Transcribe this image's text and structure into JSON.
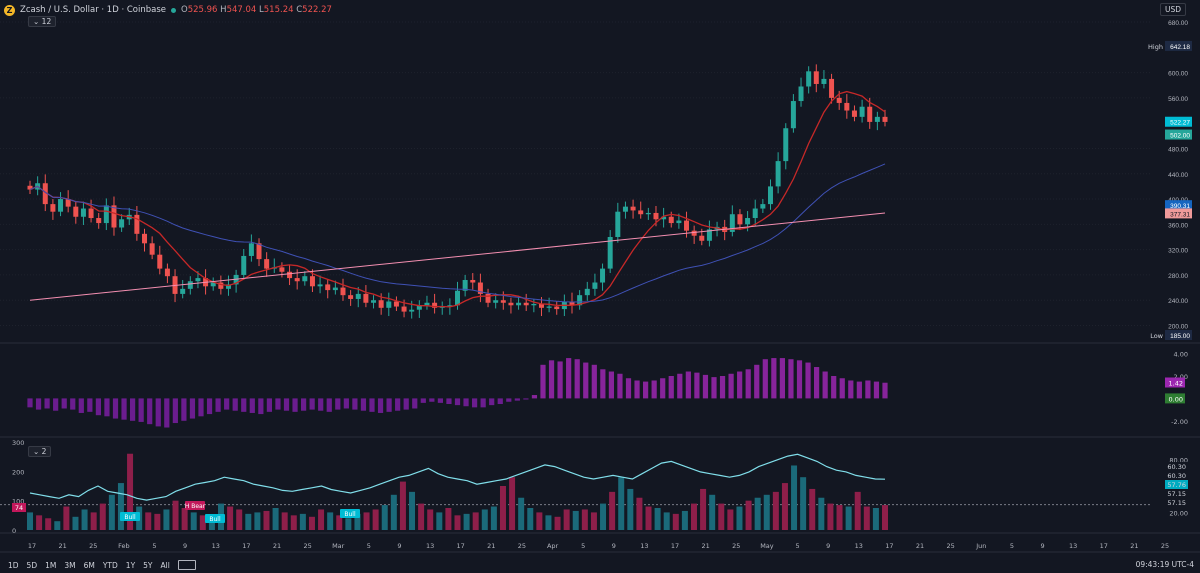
{
  "header": {
    "symbol": "Zcash / U.S. Dollar · 1D · Coinbase",
    "logo": "Z",
    "open_label": "O",
    "open": "525.96",
    "high_label": "H",
    "high": "547.04",
    "low_label": "L",
    "low": "515.24",
    "close_label": "C",
    "close": "522.27"
  },
  "toolbar": {
    "currency": "USD",
    "indicator_count_main": "12",
    "indicator_count_osc": "2",
    "timeframes": [
      "1D",
      "5D",
      "1M",
      "3M",
      "6M",
      "YTD",
      "1Y",
      "5Y",
      "All"
    ],
    "clock": "09:43:19 UTC-4"
  },
  "chart_data": [
    {
      "type": "candlestick",
      "pane": "price",
      "ylim": [
        185,
        680
      ],
      "y_ticks": [
        "680.00",
        "600.00",
        "560.00",
        "480.00",
        "440.00",
        "400.00",
        "360.00",
        "320.00",
        "280.00",
        "240.00",
        "200.00"
      ],
      "x_ticks": [
        "17",
        "21",
        "25",
        "Feb",
        "5",
        "9",
        "13",
        "17",
        "21",
        "25",
        "Mar",
        "5",
        "9",
        "13",
        "17",
        "21",
        "25",
        "Apr",
        "5",
        "9",
        "13",
        "17",
        "21",
        "25",
        "May",
        "5",
        "9",
        "13",
        "17",
        "21",
        "25",
        "Jun",
        "5",
        "9",
        "13",
        "17",
        "21",
        "25"
      ],
      "price_labels": {
        "high": "642.18",
        "high_label": "High",
        "low": "185.00",
        "low_label": "Low",
        "last": "522.27",
        "ma1": "390.31",
        "ma2": "377.31",
        "ma3": "502.00"
      },
      "candles": [
        415,
        425,
        392,
        380,
        400,
        388,
        372,
        385,
        370,
        362,
        390,
        355,
        368,
        375,
        345,
        330,
        312,
        290,
        278,
        250,
        258,
        270,
        275,
        262,
        268,
        258,
        265,
        280,
        310,
        330,
        305,
        290,
        292,
        285,
        275,
        270,
        278,
        262,
        265,
        256,
        260,
        248,
        242,
        250,
        236,
        240,
        228,
        238,
        230,
        222,
        225,
        232,
        236,
        228,
        230,
        232,
        255,
        272,
        268,
        250,
        236,
        240,
        236,
        232,
        236,
        232,
        234,
        228,
        230,
        226,
        238,
        232,
        248,
        258,
        268,
        290,
        340,
        380,
        388,
        382,
        376,
        378,
        368,
        372,
        362,
        366,
        350,
        342,
        334,
        352,
        356,
        348,
        376,
        360,
        370,
        385,
        392,
        420,
        460,
        512,
        555,
        578,
        602,
        582,
        590,
        560,
        552,
        540,
        530,
        546,
        522,
        530,
        522
      ]
    },
    {
      "type": "histogram",
      "pane": "momentum",
      "y_ticks": [
        "4.00",
        "2.00",
        "-2.00"
      ],
      "labels": {
        "current": "1.42",
        "zero": "0.00"
      },
      "values": [
        -0.8,
        -1.0,
        -0.9,
        -1.1,
        -0.9,
        -1.0,
        -1.3,
        -1.2,
        -1.5,
        -1.6,
        -1.8,
        -1.9,
        -2.0,
        -2.1,
        -2.3,
        -2.5,
        -2.6,
        -2.2,
        -2.0,
        -1.8,
        -1.6,
        -1.4,
        -1.2,
        -1.0,
        -1.1,
        -1.2,
        -1.3,
        -1.4,
        -1.2,
        -1.0,
        -1.1,
        -1.2,
        -1.1,
        -1.0,
        -1.1,
        -1.2,
        -1.0,
        -0.9,
        -1.0,
        -1.1,
        -1.2,
        -1.3,
        -1.2,
        -1.1,
        -1.0,
        -0.9,
        -0.4,
        -0.3,
        -0.4,
        -0.5,
        -0.6,
        -0.7,
        -0.8,
        -0.8,
        -0.6,
        -0.5,
        -0.3,
        -0.2,
        -0.1,
        0.3,
        3.0,
        3.4,
        3.3,
        3.6,
        3.5,
        3.2,
        3.0,
        2.6,
        2.4,
        2.2,
        1.8,
        1.6,
        1.5,
        1.6,
        1.8,
        2.0,
        2.2,
        2.4,
        2.3,
        2.1,
        1.9,
        2.0,
        2.2,
        2.4,
        2.6,
        3.0,
        3.5,
        3.6,
        3.6,
        3.5,
        3.4,
        3.2,
        2.8,
        2.4,
        2.0,
        1.8,
        1.6,
        1.5,
        1.6,
        1.5,
        1.4
      ]
    },
    {
      "type": "bar+line",
      "pane": "volume-rsi",
      "y_ticks_left": [
        "300",
        "200",
        "100",
        "0"
      ],
      "y_ticks_right": [
        "80.00",
        "20.00"
      ],
      "labels": {
        "v1": "60.30",
        "v2": "60.30",
        "v3": "57.76",
        "v4": "57.15",
        "v5": "57.15",
        "left_badge": "74"
      },
      "annotations": [
        "Bull",
        "H Bear",
        "Bull",
        "Bull"
      ],
      "volume": [
        60,
        50,
        40,
        30,
        80,
        45,
        70,
        60,
        90,
        120,
        160,
        260,
        80,
        60,
        55,
        70,
        100,
        75,
        60,
        50,
        45,
        90,
        80,
        70,
        55,
        60,
        65,
        75,
        60,
        50,
        55,
        45,
        70,
        60,
        50,
        40,
        55,
        60,
        70,
        85,
        120,
        165,
        130,
        90,
        70,
        60,
        75,
        50,
        55,
        60,
        70,
        80,
        150,
        180,
        110,
        75,
        60,
        50,
        45,
        70,
        65,
        70,
        60,
        90,
        130,
        180,
        140,
        110,
        80,
        75,
        60,
        55,
        65,
        90,
        140,
        120,
        90,
        70,
        80,
        100,
        110,
        120,
        130,
        160,
        220,
        180,
        140,
        110,
        90,
        85,
        80,
        130,
        80,
        75,
        85
      ],
      "rsi": [
        42,
        40,
        38,
        36,
        40,
        38,
        45,
        50,
        44,
        42,
        40,
        36,
        34,
        36,
        38,
        44,
        48,
        52,
        54,
        56,
        60,
        58,
        56,
        52,
        50,
        48,
        45,
        44,
        46,
        48,
        50,
        46,
        44,
        42,
        45,
        48,
        52,
        56,
        60,
        62,
        66,
        70,
        64,
        60,
        58,
        56,
        52,
        54,
        56,
        58,
        62,
        66,
        70,
        74,
        72,
        68,
        64,
        60,
        58,
        60,
        62,
        60,
        58,
        64,
        70,
        76,
        78,
        74,
        70,
        66,
        64,
        62,
        60,
        62,
        66,
        72,
        76,
        80,
        84,
        86,
        82,
        78,
        72,
        68,
        66,
        62,
        60,
        58,
        57.76
      ]
    }
  ]
}
